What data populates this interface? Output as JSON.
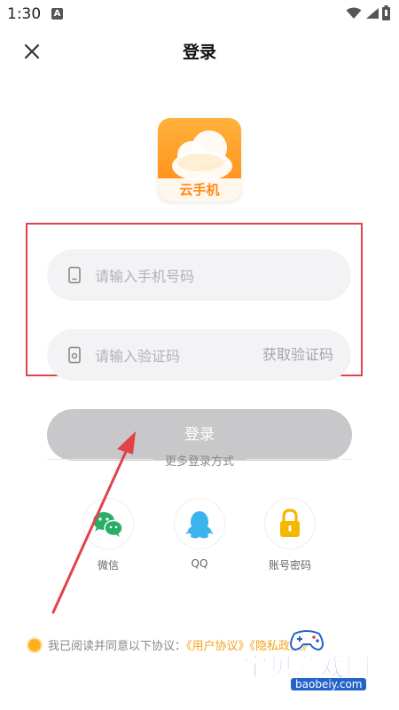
{
  "status_bar": {
    "time": "1:30",
    "notification_icon": "A"
  },
  "header": {
    "title": "登录",
    "close_icon": "close-icon"
  },
  "logo": {
    "label": "云手机"
  },
  "form": {
    "phone_placeholder": "请输入手机号码",
    "code_placeholder": "请输入验证码",
    "get_code_label": "获取验证码"
  },
  "login_button": "登录",
  "more_methods": "更多登录方式",
  "methods": [
    {
      "label": "微信",
      "icon": "wechat-icon"
    },
    {
      "label": "QQ",
      "icon": "qq-icon"
    },
    {
      "label": "账号密码",
      "icon": "lock-icon"
    }
  ],
  "agreement": {
    "text": "我已阅读并同意以下协议：",
    "user_agreement": "《用户协议》",
    "privacy_policy": "《隐私政策》"
  },
  "watermark": {
    "text": "宝贝游戏网",
    "url": "baobeiy.com"
  },
  "colors": {
    "accent": "#f4a21c",
    "highlight": "#e2434a",
    "button_disabled": "#c8c8ca"
  }
}
